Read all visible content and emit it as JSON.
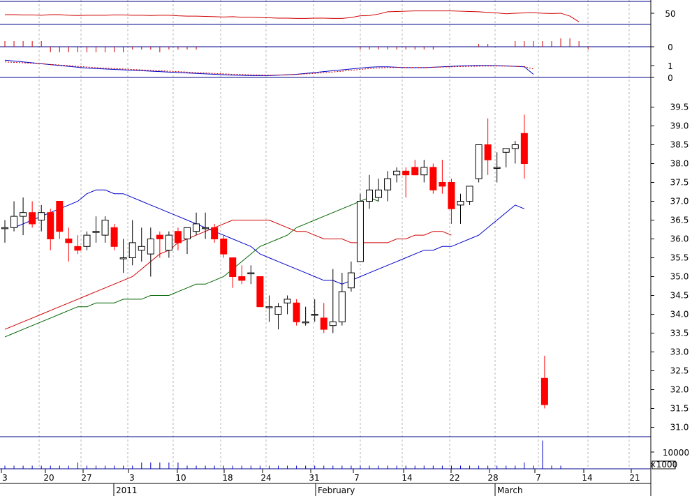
{
  "chart_data": {
    "type": "candlestick",
    "colors": {
      "up": "#ffffff",
      "down": "#ff0000",
      "up_stroke": "#000000",
      "rsi": "#d00000",
      "sma_fast": "#0000c8",
      "sma_mid": "#d00000",
      "sma_slow": "#006400",
      "macd": "#0000c8",
      "signal": "#d00000",
      "volume": "#0000c8",
      "grid": "#b4b4b4"
    },
    "date_axis": {
      "day_labels": [
        "3",
        "20",
        "27",
        "3",
        "10",
        "18",
        "24",
        "31",
        "7",
        "14",
        "22",
        "28",
        "7",
        "14",
        "21"
      ],
      "month_labels": [
        "2011",
        "February",
        "March"
      ],
      "volume_unit": "×1000"
    },
    "panels": {
      "rsi": {
        "ticks": [
          "50"
        ],
        "values": [
          63,
          63,
          62,
          62,
          61,
          63,
          63,
          61,
          60,
          61,
          61,
          61,
          62,
          62,
          61,
          61,
          60,
          61,
          61,
          59,
          58,
          58,
          57,
          56,
          55,
          56,
          54,
          54,
          53,
          52,
          51,
          51,
          50,
          50,
          51,
          51,
          50,
          50,
          53,
          59,
          60,
          65,
          73,
          74,
          75,
          76,
          76,
          76,
          76,
          76,
          75,
          74,
          73,
          71,
          69,
          66,
          68,
          69,
          70,
          68,
          67,
          68,
          58,
          38
        ]
      },
      "momentum": {
        "ticks": [
          "0"
        ],
        "values": [
          2,
          2,
          2,
          2,
          2,
          -2,
          -2,
          -2,
          -2,
          -2,
          -2,
          -2,
          -2,
          -2,
          -1,
          -1,
          -1,
          -2,
          -1,
          -1,
          -1,
          -1,
          0,
          0,
          0,
          0,
          0,
          0,
          0,
          0,
          0,
          0,
          0,
          0,
          0,
          0,
          0,
          0,
          0,
          -1,
          -1,
          -1,
          -1,
          -1,
          -1,
          -1,
          -1,
          -1,
          0,
          0,
          0,
          0,
          1,
          1,
          0,
          0,
          2,
          2,
          2,
          2,
          2,
          3,
          3,
          2,
          -1
        ]
      },
      "macd": {
        "ticks": [
          "1",
          "0"
        ],
        "macd": [
          1.2,
          1.1,
          1.0,
          0.9,
          0.8,
          0.7,
          0.6,
          0.5,
          0.4,
          0.3,
          0.25,
          0.2,
          0.15,
          0.1,
          0.05,
          0.0,
          -0.05,
          -0.1,
          -0.15,
          -0.2,
          -0.25,
          -0.3,
          -0.35,
          -0.4,
          -0.45,
          -0.5,
          -0.52,
          -0.55,
          -0.55,
          -0.55,
          -0.5,
          -0.45,
          -0.4,
          -0.3,
          -0.2,
          -0.1,
          0.0,
          0.1,
          0.2,
          0.3,
          0.4,
          0.45,
          0.45,
          0.4,
          0.35,
          0.35,
          0.35,
          0.4,
          0.45,
          0.5,
          0.55,
          0.58,
          0.6,
          0.6,
          0.58,
          0.55,
          0.5,
          0.45,
          -0.4
        ],
        "signal": [
          1.0,
          0.95,
          0.9,
          0.85,
          0.8,
          0.72,
          0.65,
          0.58,
          0.5,
          0.42,
          0.35,
          0.3,
          0.25,
          0.2,
          0.15,
          0.1,
          0.05,
          0.0,
          -0.05,
          -0.1,
          -0.15,
          -0.2,
          -0.25,
          -0.3,
          -0.35,
          -0.4,
          -0.43,
          -0.46,
          -0.48,
          -0.5,
          -0.49,
          -0.46,
          -0.42,
          -0.36,
          -0.3,
          -0.22,
          -0.14,
          -0.05,
          0.05,
          0.15,
          0.25,
          0.32,
          0.36,
          0.38,
          0.38,
          0.38,
          0.38,
          0.4,
          0.42,
          0.45,
          0.48,
          0.5,
          0.52,
          0.54,
          0.54,
          0.52,
          0.5,
          0.48,
          0.2
        ]
      },
      "price": {
        "ticks": [
          "39.5",
          "39.0",
          "38.5",
          "38.0",
          "37.5",
          "37.0",
          "36.5",
          "36.0",
          "35.5",
          "35.0",
          "34.5",
          "34.0",
          "33.5",
          "33.0",
          "32.5",
          "32.0",
          "31.5",
          "31.0"
        ],
        "ylim": [
          30.75,
          39.75
        ],
        "ohlc": [
          [
            0,
            36.3,
            36.5,
            35.9,
            36.3
          ],
          [
            1,
            36.3,
            37.0,
            36.2,
            36.6
          ],
          [
            2,
            36.6,
            37.1,
            36.1,
            36.7
          ],
          [
            3,
            36.7,
            37.0,
            36.3,
            36.4
          ],
          [
            4,
            36.5,
            36.9,
            36.2,
            36.7
          ],
          [
            5,
            36.7,
            36.8,
            35.7,
            36.0
          ],
          [
            6,
            37.0,
            37.0,
            36.0,
            36.2
          ],
          [
            7,
            36.0,
            36.3,
            35.4,
            35.9
          ],
          [
            8,
            35.8,
            36.1,
            35.6,
            35.7
          ],
          [
            9,
            35.8,
            36.2,
            35.7,
            36.1
          ],
          [
            10,
            36.2,
            36.6,
            35.9,
            36.2
          ],
          [
            11,
            36.1,
            36.6,
            35.9,
            36.5
          ],
          [
            12,
            36.3,
            36.4,
            35.7,
            35.8
          ],
          [
            13,
            35.5,
            36.0,
            35.1,
            35.5
          ],
          [
            14,
            35.5,
            36.5,
            35.3,
            35.9
          ],
          [
            15,
            35.7,
            36.3,
            35.4,
            35.8
          ],
          [
            16,
            35.6,
            36.3,
            35.0,
            36.0
          ],
          [
            17,
            36.1,
            36.2,
            35.5,
            36.0
          ],
          [
            18,
            35.7,
            36.2,
            35.5,
            36.1
          ],
          [
            19,
            36.2,
            36.3,
            35.7,
            35.9
          ],
          [
            20,
            36.0,
            36.3,
            35.6,
            36.3
          ],
          [
            21,
            36.2,
            36.7,
            36.1,
            36.4
          ],
          [
            22,
            36.3,
            36.7,
            36.0,
            36.3
          ],
          [
            23,
            36.3,
            36.4,
            35.9,
            36.0
          ],
          [
            24,
            36.0,
            36.1,
            35.5,
            35.6
          ],
          [
            25,
            35.5,
            35.5,
            34.7,
            35.0
          ],
          [
            26,
            35.0,
            35.3,
            34.8,
            34.9
          ],
          [
            27,
            35.1,
            35.3,
            34.8,
            35.1
          ],
          [
            28,
            35.0,
            35.0,
            34.2,
            34.2
          ],
          [
            29,
            34.2,
            34.5,
            33.8,
            34.2
          ],
          [
            30,
            34.0,
            34.3,
            33.6,
            34.2
          ],
          [
            31,
            34.3,
            34.5,
            34.0,
            34.4
          ],
          [
            32,
            34.3,
            34.4,
            33.7,
            33.8
          ],
          [
            33,
            33.8,
            34.2,
            33.7,
            33.8
          ],
          [
            34,
            34.0,
            34.4,
            33.8,
            34.0
          ],
          [
            35,
            33.9,
            34.3,
            33.5,
            33.6
          ],
          [
            36,
            33.7,
            35.2,
            33.5,
            33.8
          ],
          [
            37,
            33.8,
            35.1,
            33.7,
            34.6
          ],
          [
            38,
            34.7,
            35.4,
            34.6,
            35.1
          ],
          [
            39,
            35.4,
            37.2,
            35.5,
            37.0
          ],
          [
            40,
            37.0,
            37.7,
            36.8,
            37.3
          ],
          [
            41,
            37.1,
            37.6,
            37.0,
            37.3
          ],
          [
            42,
            37.3,
            37.8,
            37.0,
            37.6
          ],
          [
            43,
            37.7,
            37.9,
            37.5,
            37.8
          ],
          [
            44,
            37.8,
            37.9,
            37.1,
            37.7
          ],
          [
            45,
            37.9,
            38.1,
            37.7,
            37.7
          ],
          [
            46,
            37.7,
            38.1,
            37.5,
            37.9
          ],
          [
            47,
            37.9,
            38.0,
            37.2,
            37.3
          ],
          [
            48,
            37.5,
            38.1,
            37.2,
            37.4
          ],
          [
            49,
            37.5,
            37.6,
            36.4,
            36.8
          ],
          [
            50,
            36.9,
            37.2,
            36.4,
            37.0
          ],
          [
            51,
            37.0,
            37.4,
            36.9,
            37.4
          ],
          [
            52,
            37.6,
            38.5,
            37.5,
            38.5
          ],
          [
            53,
            38.5,
            39.2,
            37.7,
            38.1
          ],
          [
            54,
            37.9,
            38.3,
            37.5,
            37.9
          ],
          [
            55,
            38.3,
            38.4,
            37.9,
            38.4
          ],
          [
            56,
            38.4,
            38.6,
            38.0,
            38.5
          ],
          [
            57,
            38.8,
            39.3,
            37.6,
            38.0
          ],
          [
            58,
            32.3,
            32.9,
            31.5,
            31.6
          ]
        ],
        "sma_fast": [
          36.3,
          36.4,
          36.5,
          36.6,
          36.7,
          36.8,
          36.9,
          37.0,
          37.2,
          37.3,
          37.3,
          37.2,
          37.2,
          37.1,
          37.0,
          36.9,
          36.8,
          36.7,
          36.6,
          36.5,
          36.4,
          36.3,
          36.2,
          36.1,
          36.0,
          35.9,
          35.8,
          35.6,
          35.5,
          35.4,
          35.3,
          35.2,
          35.1,
          35.0,
          34.9,
          34.9,
          34.8,
          34.9,
          35.0,
          35.1,
          35.2,
          35.3,
          35.4,
          35.5,
          35.6,
          35.7,
          35.7,
          35.8,
          35.8,
          35.9,
          36.0,
          36.1,
          36.3,
          36.5,
          36.7,
          36.9,
          36.8
        ],
        "sma_mid": [
          33.6,
          33.7,
          33.8,
          33.9,
          34.0,
          34.1,
          34.2,
          34.3,
          34.4,
          34.5,
          34.6,
          34.7,
          34.8,
          34.9,
          35.0,
          35.2,
          35.4,
          35.6,
          35.7,
          35.9,
          36.0,
          36.1,
          36.2,
          36.3,
          36.4,
          36.5,
          36.5,
          36.5,
          36.5,
          36.5,
          36.4,
          36.3,
          36.2,
          36.2,
          36.1,
          36.0,
          36.0,
          36.0,
          35.9,
          35.9,
          35.9,
          35.9,
          35.9,
          36.0,
          36.0,
          36.1,
          36.1,
          36.2,
          36.2,
          36.1
        ],
        "sma_slow": [
          33.4,
          33.5,
          33.6,
          33.7,
          33.8,
          33.9,
          34.0,
          34.1,
          34.2,
          34.2,
          34.3,
          34.3,
          34.3,
          34.4,
          34.4,
          34.4,
          34.5,
          34.5,
          34.5,
          34.6,
          34.7,
          34.8,
          34.8,
          34.9,
          35.0,
          35.2,
          35.4,
          35.6,
          35.8,
          35.9,
          36.0,
          36.1,
          36.3,
          36.4,
          36.5,
          36.6,
          36.7,
          36.8,
          36.9,
          37.0,
          37.1,
          37.0
        ]
      },
      "volume": {
        "ticks": [
          "10000"
        ],
        "values": [
          1,
          1,
          1,
          1,
          1,
          1,
          1,
          1,
          2,
          1,
          1,
          1,
          1,
          1,
          1,
          2,
          2,
          2,
          2,
          2,
          1,
          1,
          1,
          1,
          1,
          1,
          1,
          1,
          1,
          1,
          1,
          1,
          1,
          1,
          1,
          1,
          1,
          1,
          1,
          1,
          1,
          1,
          1,
          1,
          1,
          1,
          1,
          1,
          1,
          1,
          1,
          1,
          1,
          1,
          1,
          1,
          1,
          2,
          1,
          1,
          1,
          1,
          9
        ]
      }
    }
  }
}
